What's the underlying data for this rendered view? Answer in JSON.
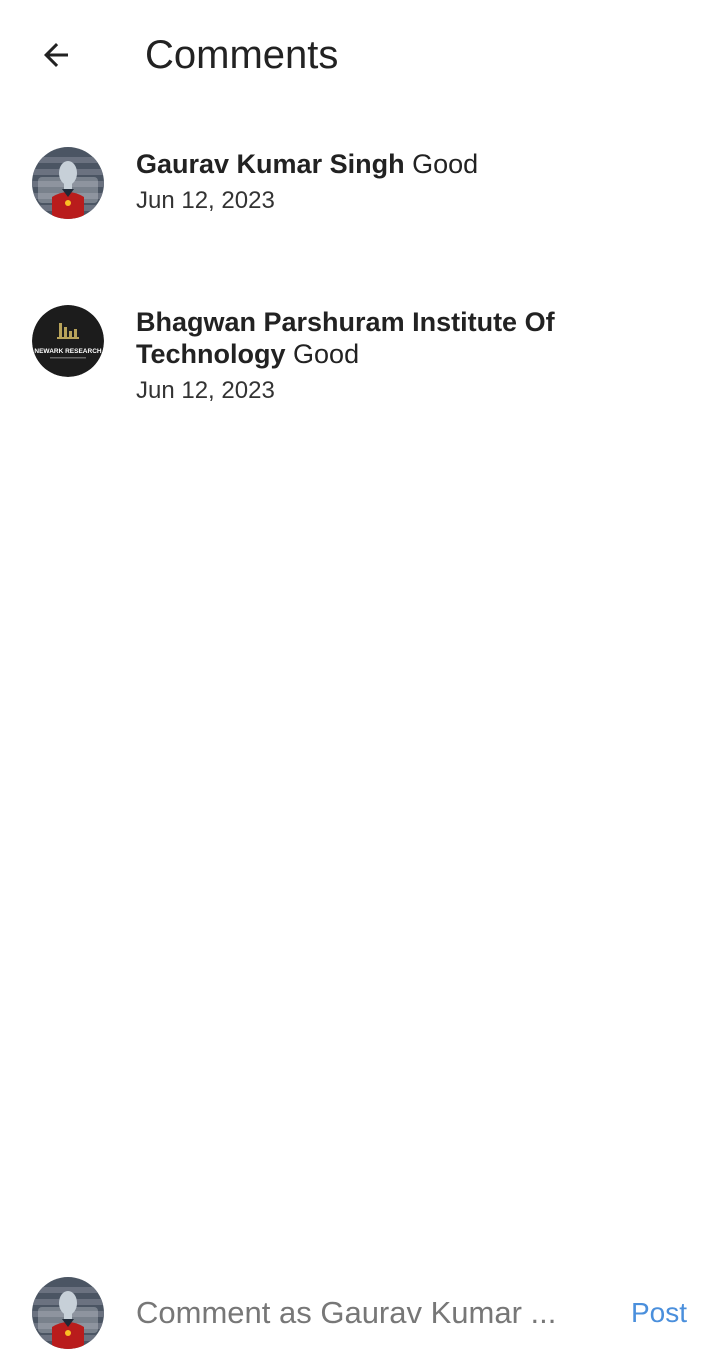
{
  "header": {
    "title": "Comments",
    "back_icon": "arrow-left-icon"
  },
  "comments": [
    {
      "author": "Gaurav Kumar Singh",
      "text": "Good",
      "date": "Jun 12, 2023",
      "avatar": "person-avatar"
    },
    {
      "author": "Bhagwan Parshuram Institute Of Technology",
      "text": "Good",
      "date": "Jun 12, 2023",
      "avatar": "newark-research-logo",
      "avatar_text": "NEWARK RESEARCH"
    }
  ],
  "composer": {
    "placeholder": "Comment as Gaurav Kumar ...",
    "post_label": "Post",
    "avatar": "person-avatar"
  },
  "colors": {
    "accent": "#4a8fdc",
    "text": "#222222",
    "background": "#ffffff"
  }
}
